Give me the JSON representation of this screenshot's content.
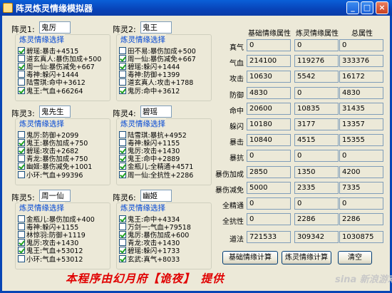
{
  "window": {
    "title": "阵灵炼灵情缘模拟器",
    "min": "_",
    "max": "□",
    "close": "×"
  },
  "spirits": [
    {
      "label": "阵灵1:",
      "name": "鬼厉",
      "group": "炼灵情缘选择",
      "items": [
        {
          "text": "碧瑶:暴击+4515",
          "checked": true
        },
        {
          "text": "道玄真人:暴伤加成+500",
          "checked": false
        },
        {
          "text": "周一仙:暴伤减免+667",
          "checked": true
        },
        {
          "text": "毒神:躲闪+1444",
          "checked": false
        },
        {
          "text": "陆雪琪:命中+3612",
          "checked": false
        },
        {
          "text": "鬼王:气血+66264",
          "checked": true
        }
      ]
    },
    {
      "label": "阵灵2:",
      "name": "鬼王",
      "group": "炼灵情缘选择",
      "items": [
        {
          "text": "田不易:暴伤加成+500",
          "checked": false
        },
        {
          "text": "周一仙:暴伤减免+667",
          "checked": true
        },
        {
          "text": "碧瑶:躲闪+1444",
          "checked": true
        },
        {
          "text": "毒神:防御+1399",
          "checked": false
        },
        {
          "text": "道玄真人:攻击+1788",
          "checked": false
        },
        {
          "text": "鬼厉:命中+3612",
          "checked": true
        }
      ]
    },
    {
      "label": "阵灵3:",
      "name": "鬼先生",
      "group": "炼灵情缘选择",
      "items": [
        {
          "text": "鬼厉:防御+2099",
          "checked": false
        },
        {
          "text": "鬼王:暴伤加成+750",
          "checked": true
        },
        {
          "text": "碧瑶:攻击+2682",
          "checked": true
        },
        {
          "text": "青龙:暴伤加成+750",
          "checked": false
        },
        {
          "text": "幽姬:暴伤减免+1001",
          "checked": true
        },
        {
          "text": "小环:气血+99396",
          "checked": false
        }
      ]
    },
    {
      "label": "阵灵4:",
      "name": "碧瑶",
      "group": "炼灵情缘选择",
      "items": [
        {
          "text": "陆雪琪:暴抗+4952",
          "checked": false
        },
        {
          "text": "毒神:躲闪+1155",
          "checked": false
        },
        {
          "text": "鬼厉:攻击+1430",
          "checked": true
        },
        {
          "text": "鬼王:命中+2889",
          "checked": true
        },
        {
          "text": "金瓶儿:全精通+4571",
          "checked": true
        },
        {
          "text": "周一仙:全抗性+2286",
          "checked": true
        }
      ]
    },
    {
      "label": "阵灵5:",
      "name": "周一仙",
      "group": "炼灵情缘选择",
      "items": [
        {
          "text": "金瓶儿:暴伤加成+400",
          "checked": false
        },
        {
          "text": "毒神:躲闪+1155",
          "checked": false
        },
        {
          "text": "林惊羽:防御+1119",
          "checked": false
        },
        {
          "text": "鬼厉:攻击+1430",
          "checked": true
        },
        {
          "text": "鬼王:气血+53012",
          "checked": true
        },
        {
          "text": "小环:气血+53012",
          "checked": false
        }
      ]
    },
    {
      "label": "阵灵6:",
      "name": "幽姬",
      "group": "炼灵情缘选择",
      "items": [
        {
          "text": "鬼王:命中+4334",
          "checked": true
        },
        {
          "text": "万剑一:气血+79518",
          "checked": false
        },
        {
          "text": "鬼厉:暴伤加成+600",
          "checked": true
        },
        {
          "text": "青龙:攻击+1430",
          "checked": false
        },
        {
          "text": "碧瑶:躲闪+1733",
          "checked": true
        },
        {
          "text": "玄武:真气+8033",
          "checked": true
        }
      ]
    }
  ],
  "stats": {
    "headers": [
      "基础情缘属性",
      "炼灵情缘属性",
      "总属性"
    ],
    "rows": [
      {
        "label": "真气",
        "values": [
          "0",
          "0",
          "0"
        ]
      },
      {
        "label": "气血",
        "values": [
          "214100",
          "119276",
          "333376"
        ]
      },
      {
        "label": "攻击",
        "values": [
          "10630",
          "5542",
          "16172"
        ]
      },
      {
        "label": "防御",
        "values": [
          "4830",
          "0",
          "4830"
        ]
      },
      {
        "label": "命中",
        "values": [
          "20600",
          "10835",
          "31435"
        ]
      },
      {
        "label": "躲闪",
        "values": [
          "10180",
          "3177",
          "13357"
        ]
      },
      {
        "label": "暴击",
        "values": [
          "10840",
          "4515",
          "15355"
        ]
      },
      {
        "label": "暴抗",
        "values": [
          "0",
          "0",
          "0"
        ]
      },
      {
        "label": "暴伤加成",
        "values": [
          "2850",
          "1350",
          "4200"
        ]
      },
      {
        "label": "暴伤减免",
        "values": [
          "5000",
          "2335",
          "7335"
        ]
      },
      {
        "label": "全精通",
        "values": [
          "0",
          "0",
          "0"
        ]
      },
      {
        "label": "全抗性",
        "values": [
          "0",
          "2286",
          "2286"
        ]
      },
      {
        "label": "道法",
        "values": [
          "721533",
          "309342",
          "1030875"
        ]
      }
    ]
  },
  "buttons": {
    "base": "基础情缘计算",
    "refine": "炼灵情缘计算",
    "clear": "清空"
  },
  "footer": {
    "pre": "本程序由幻月府",
    "bracket_open": "【",
    "author": "诡夜",
    "bracket_close": "】",
    "post": "提供"
  },
  "watermark": "sina 新浪游戏"
}
